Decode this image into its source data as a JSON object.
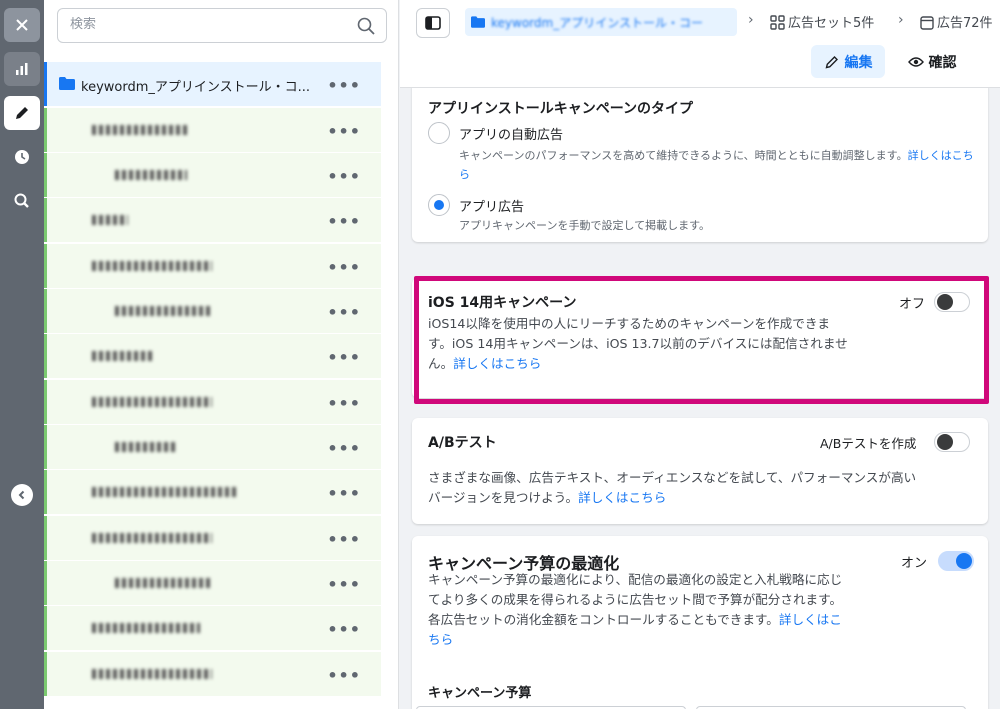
{
  "rail": {
    "close_icon": "×",
    "chart_icon": "bar-chart",
    "edit_icon": "pencil",
    "clock_icon": "clock",
    "search_icon": "magnifier-chart"
  },
  "tree": {
    "search_placeholder": "検索",
    "campaign_label": "keywordm_アプリインストール・コ...",
    "items": [
      {
        "text": "　　　　　　　　",
        "indent": 1
      },
      {
        "text": "　　　　　　",
        "indent": 2
      },
      {
        "text": "　　　",
        "indent": 1
      },
      {
        "text": "　　　　　　　　　　",
        "indent": 1
      },
      {
        "text": "　　　　　　　　",
        "indent": 2
      },
      {
        "text": "　　　　　",
        "indent": 1
      },
      {
        "text": "　　　　　　　　　　",
        "indent": 1
      },
      {
        "text": "　　　　　",
        "indent": 2
      },
      {
        "text": "　　　　　　　　　　　　",
        "indent": 1
      },
      {
        "text": "　　　　　　　　　　",
        "indent": 1
      },
      {
        "text": "　　　　　　　　",
        "indent": 2
      },
      {
        "text": "　　　　　　　　　",
        "indent": 1
      },
      {
        "text": "　　　　　　　　　　",
        "indent": 1
      }
    ]
  },
  "header": {
    "campaign_crumb": "keywordm_アプリインストール・コー",
    "adset_crumb": "広告セット5件",
    "ad_crumb": "広告72件",
    "edit_label": "編集",
    "review_label": "確認"
  },
  "app_install_type": {
    "title": "アプリインストールキャンペーンのタイプ",
    "option1_label": "アプリの自動広告",
    "option1_desc": "キャンペーンのパフォーマンスを高めて維持できるように、時間とともに自動調整します。",
    "option1_link": "詳しくはこちら",
    "option2_label": "アプリ広告",
    "option2_desc": "アプリキャンペーンを手動で設定して掲載します。",
    "selected": "アプリ広告"
  },
  "ios14": {
    "title": "iOS 14用キャンペーン",
    "toggle_label": "オフ",
    "desc_line1": "iOS14以降を使用中の人にリーチするためのキャンペーンを作成できま",
    "desc_line2": "す。iOS 14用キャンペーンは、iOS 13.7以前のデバイスには配信されませ",
    "desc_line3": "ん。",
    "link": "詳しくはこちら"
  },
  "ab_test": {
    "title": "A/Bテスト",
    "toggle_label": "A/Bテストを作成",
    "desc_line1": "さまざまな画像、広告テキスト、オーディエンスなどを試して、パフォーマンスが高い",
    "desc_line2": "バージョンを見つけよう。",
    "link": "詳しくはこちら"
  },
  "budget_opt": {
    "title": "キャンペーン予算の最適化",
    "toggle_label": "オン",
    "desc_line1": "キャンペーン予算の最適化により、配信の最適化の設定と入札戦略に応じ",
    "desc_line2": "てより多くの成果を得られるように広告セット間で予算が配分されます。",
    "desc_line3": "各広告セットの消化金額をコントロールすることもできます。",
    "link1": "詳しくはこ",
    "link2": "ちら",
    "budget_label": "キャンペーン予算"
  },
  "colors": {
    "accent": "#1877f2",
    "highlight": "#d0087a"
  }
}
